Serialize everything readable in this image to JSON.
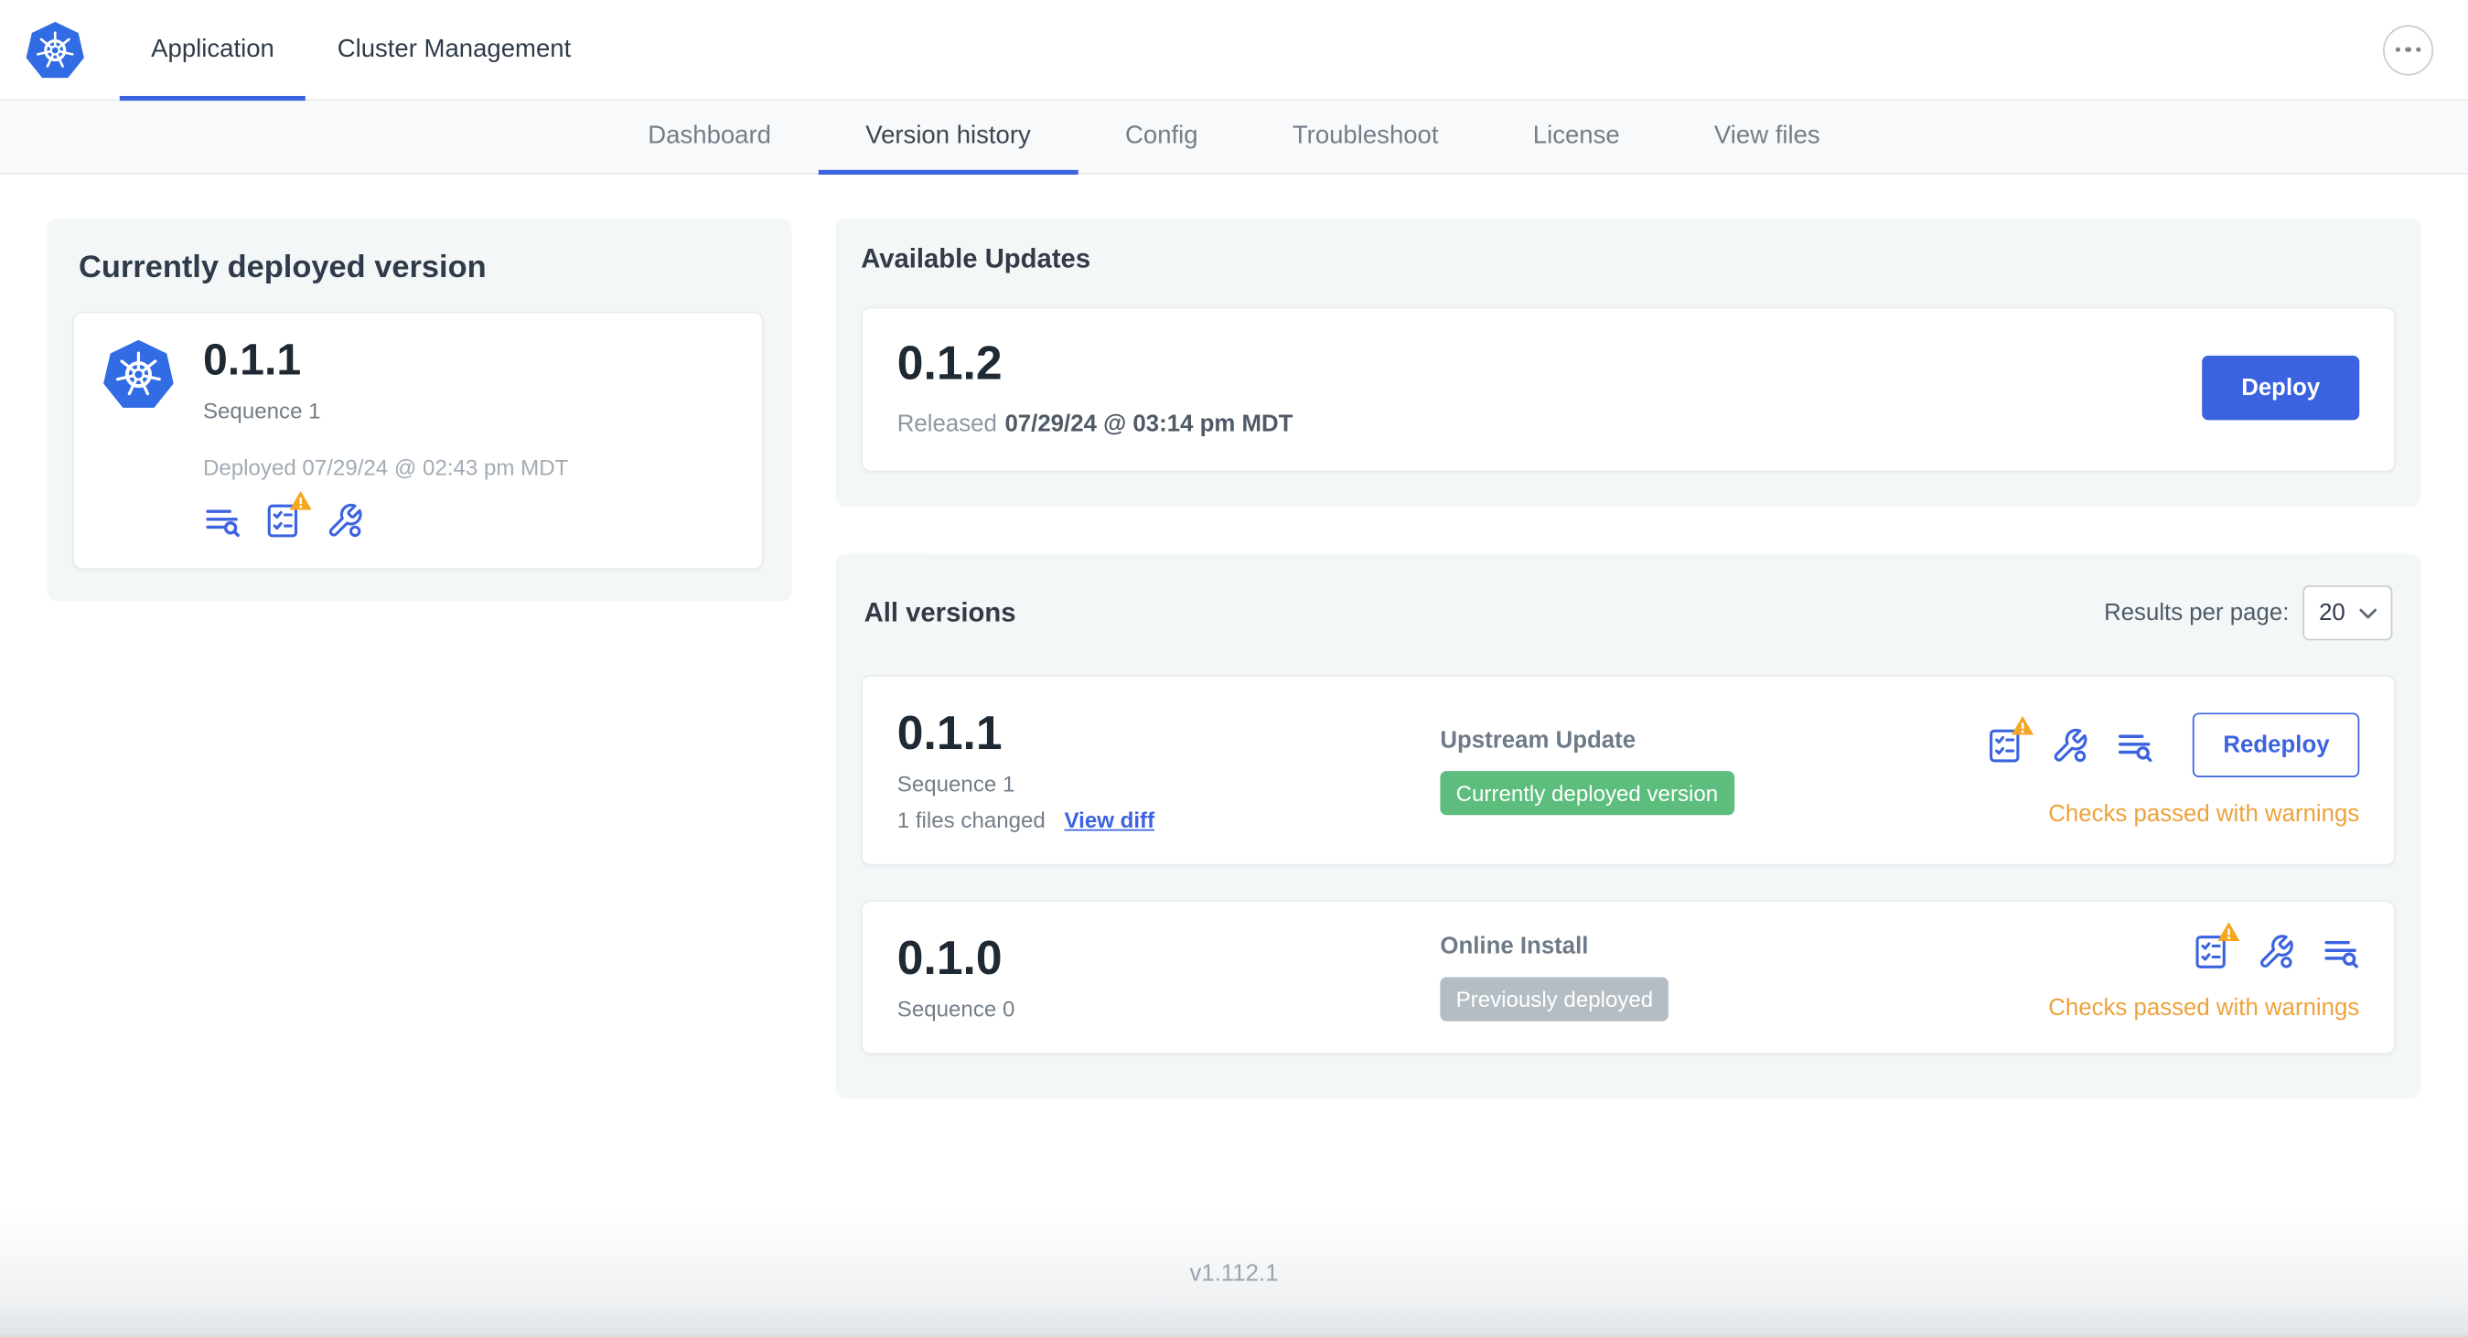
{
  "colors": {
    "accent_blue": "#3b63e0",
    "kubernetes_blue": "#326ce5",
    "badge_green": "#5cbd7d",
    "badge_gray": "#b4bdc4",
    "warning_orange": "#eda23b"
  },
  "icons": {
    "logo": "kubernetes-logo",
    "more": "ellipsis-icon",
    "release_notes": "release-notes-icon",
    "preflight": "preflight-checks-icon",
    "config": "edit-config-icon",
    "warning": "warning-triangle-icon",
    "select_chevron": "chevron-down-icon"
  },
  "topnav": {
    "tabs": [
      {
        "label": "Application",
        "active": true
      },
      {
        "label": "Cluster Management",
        "active": false
      }
    ]
  },
  "subnav": {
    "items": [
      "Dashboard",
      "Version history",
      "Config",
      "Troubleshoot",
      "License",
      "View files"
    ],
    "active": "Version history"
  },
  "current_version": {
    "title": "Currently deployed version",
    "version": "0.1.1",
    "sequence": "Sequence 1",
    "deployed": "Deployed 07/29/24 @ 02:43 pm MDT"
  },
  "available_updates": {
    "title": "Available Updates",
    "version": "0.1.2",
    "released_label": "Released",
    "released_date": "07/29/24 @ 03:14 pm MDT",
    "deploy_button": "Deploy"
  },
  "all_versions": {
    "title": "All versions",
    "results_per_page_label": "Results per page:",
    "results_per_page_value": "20",
    "rows": [
      {
        "version": "0.1.1",
        "sequence": "Sequence 1",
        "files_changed": "1 files changed",
        "diff_link": "View diff",
        "source": "Upstream Update",
        "badge": "Currently deployed version",
        "status": "Checks passed with warnings",
        "action": "Redeploy"
      },
      {
        "version": "0.1.0",
        "sequence": "Sequence 0",
        "source": "Online Install",
        "badge": "Previously deployed",
        "status": "Checks passed with warnings"
      }
    ]
  },
  "footer": {
    "version_label": "v1.112.1"
  }
}
